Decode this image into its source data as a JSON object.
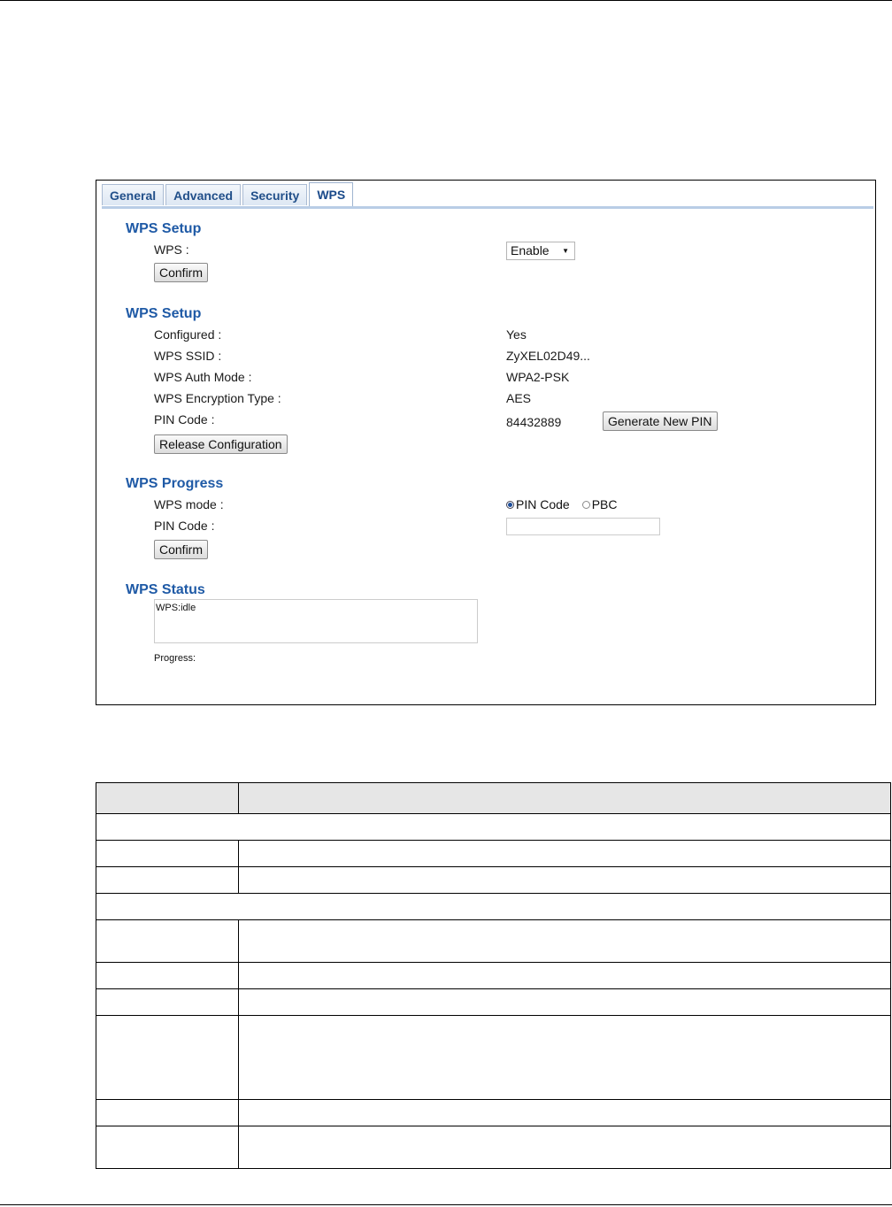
{
  "tabs": [
    "General",
    "Advanced",
    "Security",
    "WPS"
  ],
  "active_tab": "WPS",
  "wps_setup": {
    "title": "WPS Setup",
    "wps_label": "WPS :",
    "wps_value": "Enable",
    "confirm_label": "Confirm"
  },
  "wps_info": {
    "title": "WPS Setup",
    "rows": [
      {
        "label": "Configured :",
        "value": "Yes"
      },
      {
        "label": "WPS SSID :",
        "value": "ZyXEL02D49..."
      },
      {
        "label": "WPS Auth Mode :",
        "value": "WPA2-PSK"
      },
      {
        "label": "WPS Encryption Type :",
        "value": "AES"
      },
      {
        "label": "PIN Code :",
        "value": "84432889"
      }
    ],
    "generate_pin_label": "Generate New PIN",
    "release_label": "Release Configuration"
  },
  "wps_progress": {
    "title": "WPS Progress",
    "mode_label": "WPS mode :",
    "mode_options": [
      "PIN Code",
      "PBC"
    ],
    "mode_selected": "PIN Code",
    "pin_label": "PIN Code :",
    "pin_value": "",
    "confirm_label": "Confirm"
  },
  "wps_status": {
    "title": "WPS Status",
    "status_text": "WPS:idle",
    "progress_label": "Progress:"
  }
}
